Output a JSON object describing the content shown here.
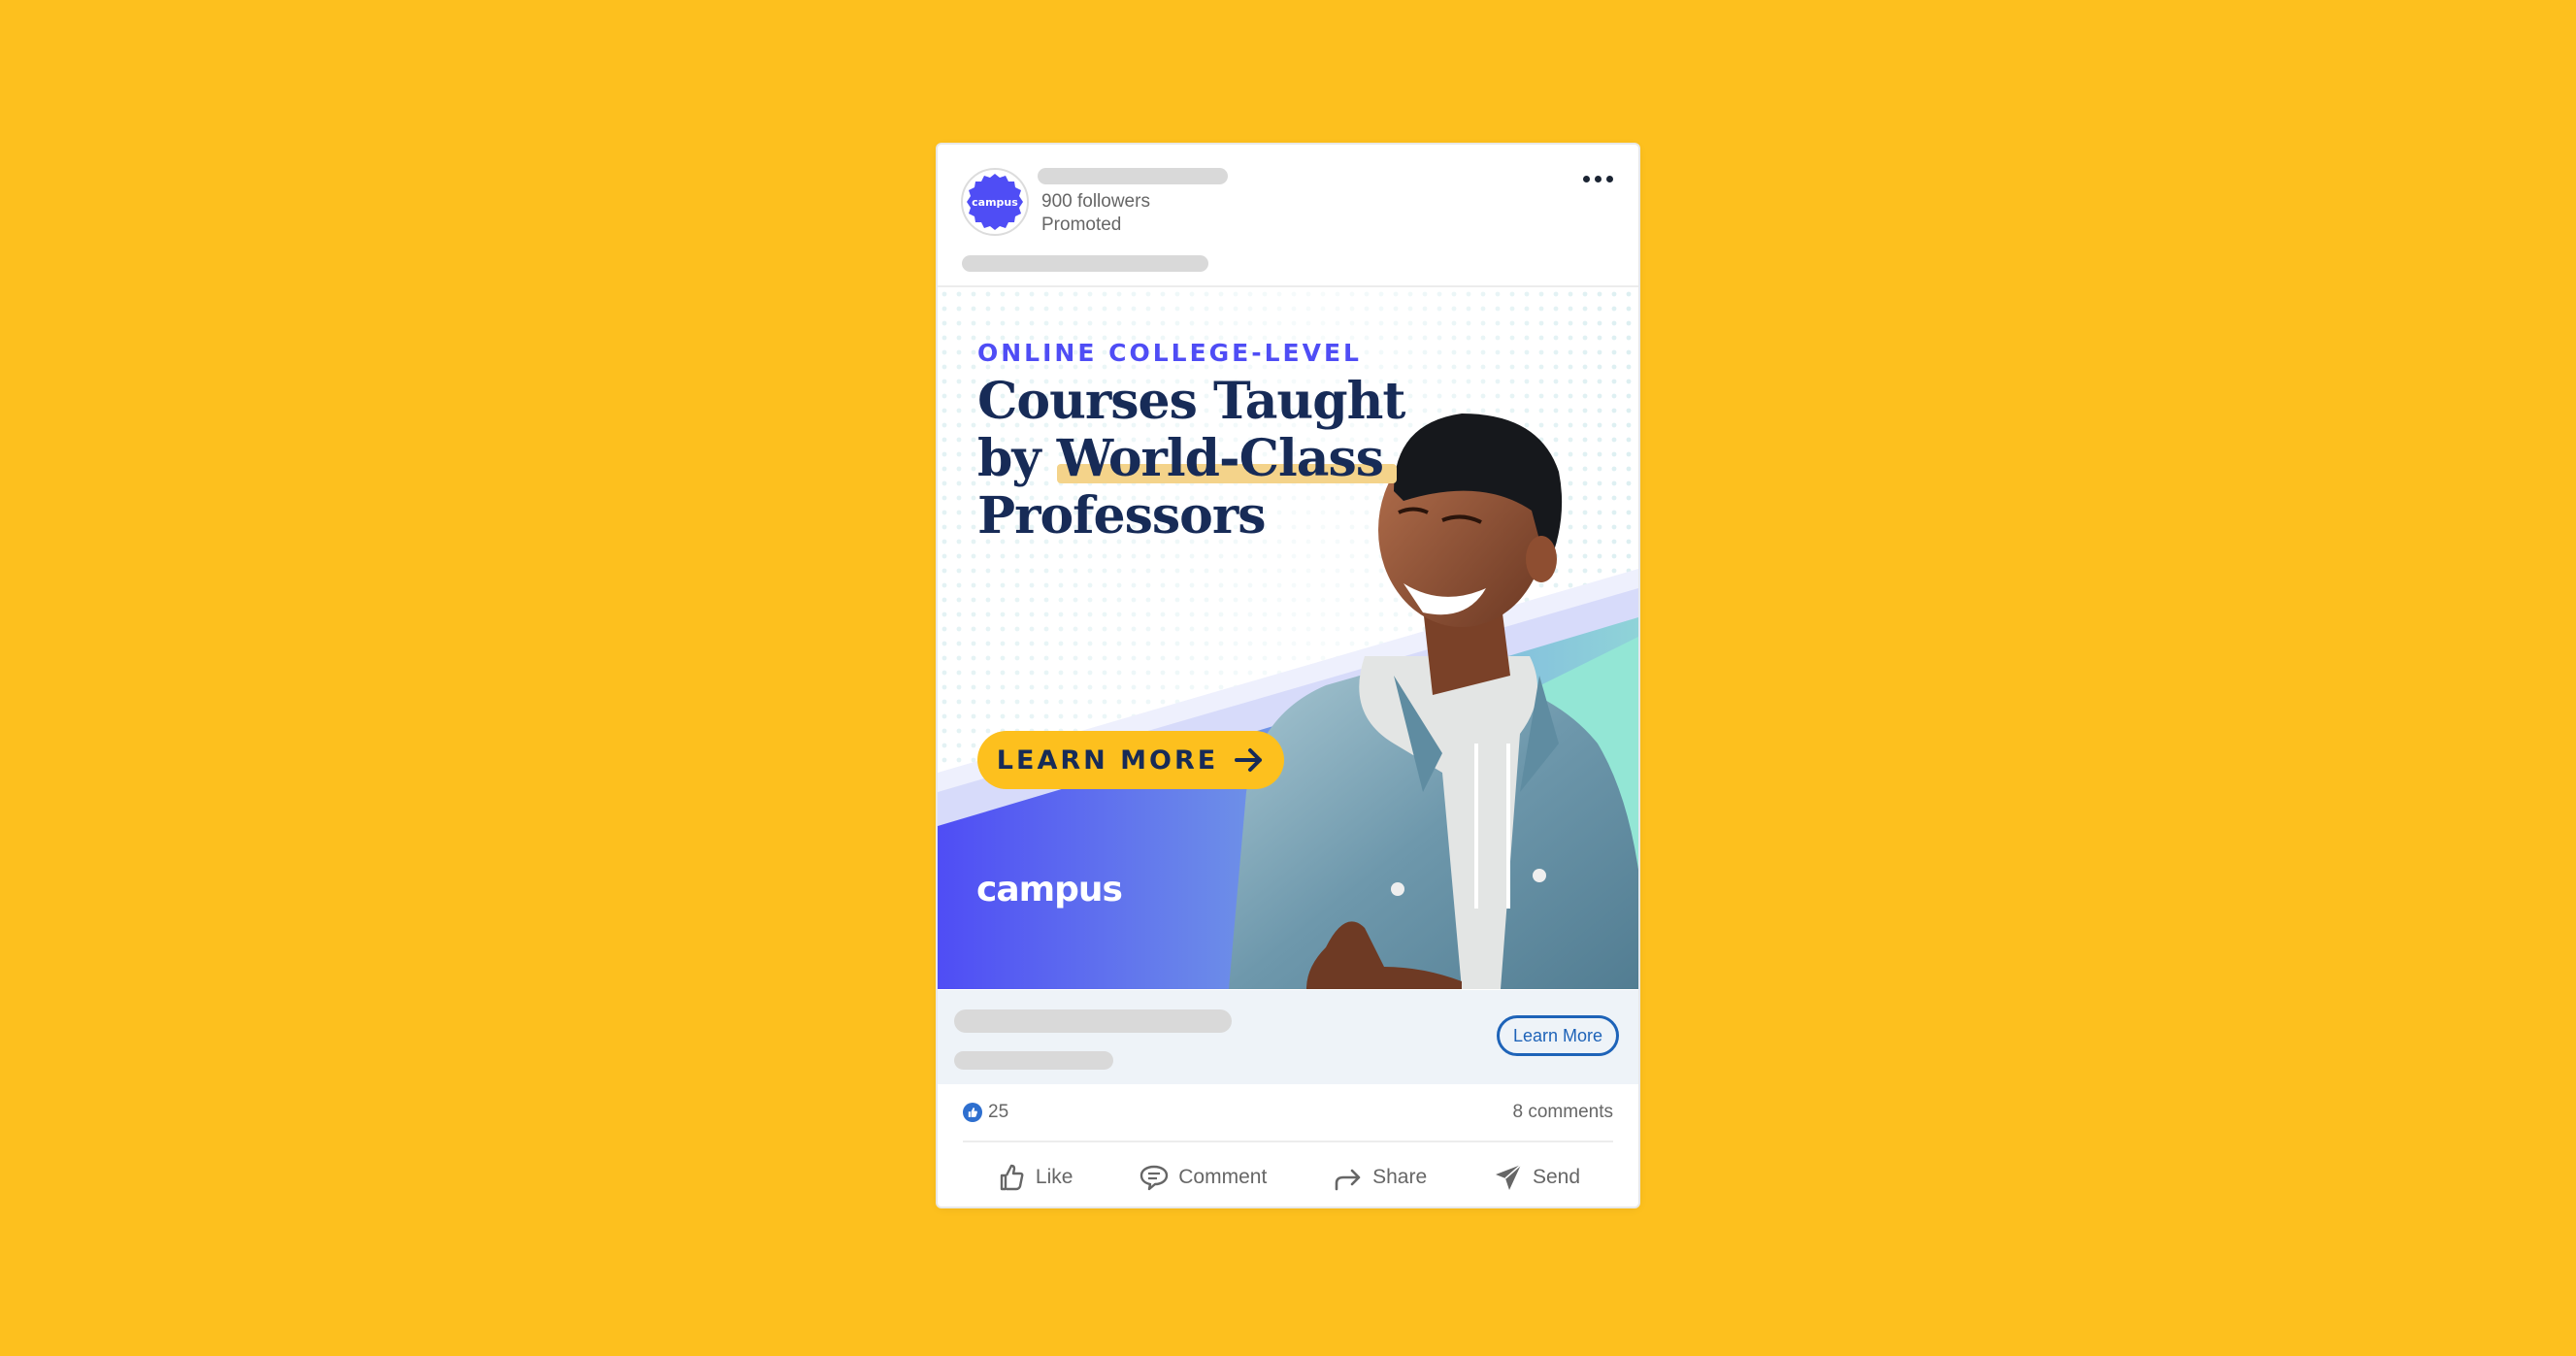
{
  "post": {
    "author": {
      "logo_text": "campus",
      "followers": "900 followers",
      "promoted": "Promoted"
    },
    "menu_icon": "more-horizontal-icon"
  },
  "ad": {
    "eyebrow": "ONLINE COLLEGE-LEVEL",
    "headline": {
      "line1": "Courses Taught",
      "line2_prefix": "by ",
      "line2_highlight": "World-Class",
      "line3": "Professors"
    },
    "cta_label": "LEARN MORE",
    "cta_icon": "arrow-right-icon",
    "brand": "campus",
    "colors": {
      "eyebrow": "#4F4DF5",
      "headline": "#172B57",
      "highlight": "#F4D38A",
      "cta_bg": "#FDC01E",
      "gradient_start": "#4F4DF5",
      "gradient_end": "#86C9DA",
      "mint": "#93E6D5"
    }
  },
  "cta_bar": {
    "button_label": "Learn More"
  },
  "social": {
    "reaction_icon": "thumbs-up-icon",
    "reaction_count": "25",
    "comments": "8 comments"
  },
  "actions": [
    {
      "label": "Like",
      "icon": "thumbs-up-icon"
    },
    {
      "label": "Comment",
      "icon": "comment-icon"
    },
    {
      "label": "Share",
      "icon": "share-icon"
    },
    {
      "label": "Send",
      "icon": "send-icon"
    }
  ],
  "theme": {
    "page_bg": "#FDC01E",
    "link_blue": "#1E63B8"
  }
}
